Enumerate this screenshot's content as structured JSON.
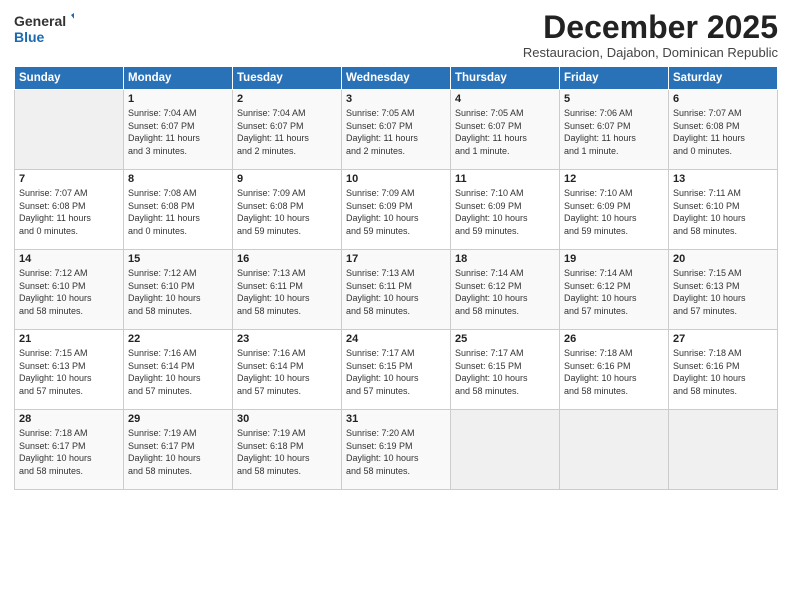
{
  "logo": {
    "line1": "General",
    "line2": "Blue"
  },
  "title": "December 2025",
  "subtitle": "Restauracion, Dajabon, Dominican Republic",
  "days_of_week": [
    "Sunday",
    "Monday",
    "Tuesday",
    "Wednesday",
    "Thursday",
    "Friday",
    "Saturday"
  ],
  "weeks": [
    [
      {
        "day": "",
        "content": ""
      },
      {
        "day": "1",
        "content": "Sunrise: 7:04 AM\nSunset: 6:07 PM\nDaylight: 11 hours\nand 3 minutes."
      },
      {
        "day": "2",
        "content": "Sunrise: 7:04 AM\nSunset: 6:07 PM\nDaylight: 11 hours\nand 2 minutes."
      },
      {
        "day": "3",
        "content": "Sunrise: 7:05 AM\nSunset: 6:07 PM\nDaylight: 11 hours\nand 2 minutes."
      },
      {
        "day": "4",
        "content": "Sunrise: 7:05 AM\nSunset: 6:07 PM\nDaylight: 11 hours\nand 1 minute."
      },
      {
        "day": "5",
        "content": "Sunrise: 7:06 AM\nSunset: 6:07 PM\nDaylight: 11 hours\nand 1 minute."
      },
      {
        "day": "6",
        "content": "Sunrise: 7:07 AM\nSunset: 6:08 PM\nDaylight: 11 hours\nand 0 minutes."
      }
    ],
    [
      {
        "day": "7",
        "content": "Sunrise: 7:07 AM\nSunset: 6:08 PM\nDaylight: 11 hours\nand 0 minutes."
      },
      {
        "day": "8",
        "content": "Sunrise: 7:08 AM\nSunset: 6:08 PM\nDaylight: 11 hours\nand 0 minutes."
      },
      {
        "day": "9",
        "content": "Sunrise: 7:09 AM\nSunset: 6:08 PM\nDaylight: 10 hours\nand 59 minutes."
      },
      {
        "day": "10",
        "content": "Sunrise: 7:09 AM\nSunset: 6:09 PM\nDaylight: 10 hours\nand 59 minutes."
      },
      {
        "day": "11",
        "content": "Sunrise: 7:10 AM\nSunset: 6:09 PM\nDaylight: 10 hours\nand 59 minutes."
      },
      {
        "day": "12",
        "content": "Sunrise: 7:10 AM\nSunset: 6:09 PM\nDaylight: 10 hours\nand 59 minutes."
      },
      {
        "day": "13",
        "content": "Sunrise: 7:11 AM\nSunset: 6:10 PM\nDaylight: 10 hours\nand 58 minutes."
      }
    ],
    [
      {
        "day": "14",
        "content": "Sunrise: 7:12 AM\nSunset: 6:10 PM\nDaylight: 10 hours\nand 58 minutes."
      },
      {
        "day": "15",
        "content": "Sunrise: 7:12 AM\nSunset: 6:10 PM\nDaylight: 10 hours\nand 58 minutes."
      },
      {
        "day": "16",
        "content": "Sunrise: 7:13 AM\nSunset: 6:11 PM\nDaylight: 10 hours\nand 58 minutes."
      },
      {
        "day": "17",
        "content": "Sunrise: 7:13 AM\nSunset: 6:11 PM\nDaylight: 10 hours\nand 58 minutes."
      },
      {
        "day": "18",
        "content": "Sunrise: 7:14 AM\nSunset: 6:12 PM\nDaylight: 10 hours\nand 58 minutes."
      },
      {
        "day": "19",
        "content": "Sunrise: 7:14 AM\nSunset: 6:12 PM\nDaylight: 10 hours\nand 57 minutes."
      },
      {
        "day": "20",
        "content": "Sunrise: 7:15 AM\nSunset: 6:13 PM\nDaylight: 10 hours\nand 57 minutes."
      }
    ],
    [
      {
        "day": "21",
        "content": "Sunrise: 7:15 AM\nSunset: 6:13 PM\nDaylight: 10 hours\nand 57 minutes."
      },
      {
        "day": "22",
        "content": "Sunrise: 7:16 AM\nSunset: 6:14 PM\nDaylight: 10 hours\nand 57 minutes."
      },
      {
        "day": "23",
        "content": "Sunrise: 7:16 AM\nSunset: 6:14 PM\nDaylight: 10 hours\nand 57 minutes."
      },
      {
        "day": "24",
        "content": "Sunrise: 7:17 AM\nSunset: 6:15 PM\nDaylight: 10 hours\nand 57 minutes."
      },
      {
        "day": "25",
        "content": "Sunrise: 7:17 AM\nSunset: 6:15 PM\nDaylight: 10 hours\nand 58 minutes."
      },
      {
        "day": "26",
        "content": "Sunrise: 7:18 AM\nSunset: 6:16 PM\nDaylight: 10 hours\nand 58 minutes."
      },
      {
        "day": "27",
        "content": "Sunrise: 7:18 AM\nSunset: 6:16 PM\nDaylight: 10 hours\nand 58 minutes."
      }
    ],
    [
      {
        "day": "28",
        "content": "Sunrise: 7:18 AM\nSunset: 6:17 PM\nDaylight: 10 hours\nand 58 minutes."
      },
      {
        "day": "29",
        "content": "Sunrise: 7:19 AM\nSunset: 6:17 PM\nDaylight: 10 hours\nand 58 minutes."
      },
      {
        "day": "30",
        "content": "Sunrise: 7:19 AM\nSunset: 6:18 PM\nDaylight: 10 hours\nand 58 minutes."
      },
      {
        "day": "31",
        "content": "Sunrise: 7:20 AM\nSunset: 6:19 PM\nDaylight: 10 hours\nand 58 minutes."
      },
      {
        "day": "",
        "content": ""
      },
      {
        "day": "",
        "content": ""
      },
      {
        "day": "",
        "content": ""
      }
    ]
  ]
}
